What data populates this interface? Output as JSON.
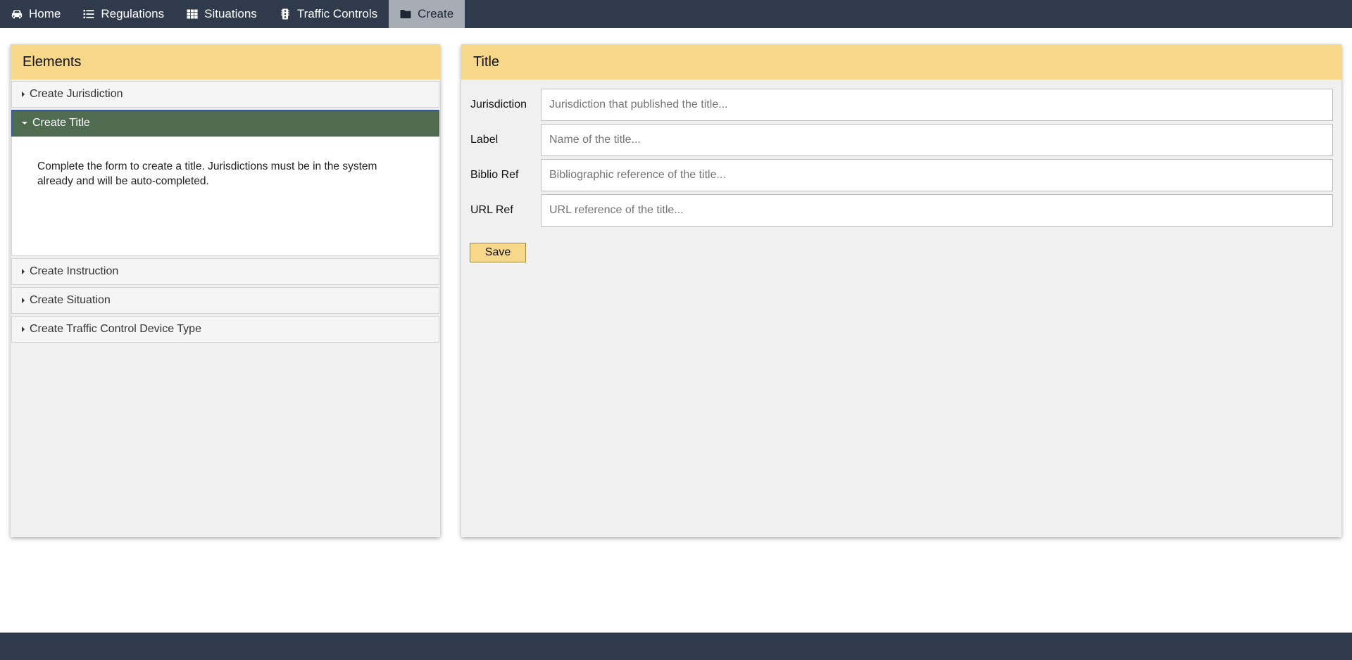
{
  "nav": {
    "items": [
      {
        "label": "Home",
        "icon": "car-icon"
      },
      {
        "label": "Regulations",
        "icon": "list-icon"
      },
      {
        "label": "Situations",
        "icon": "table-icon"
      },
      {
        "label": "Traffic Controls",
        "icon": "traffic-light-icon"
      },
      {
        "label": "Create",
        "icon": "folder-plus-icon",
        "active": true
      }
    ]
  },
  "elements_panel": {
    "title": "Elements",
    "items": [
      {
        "label": "Create Jurisdiction",
        "expanded": false
      },
      {
        "label": "Create Title",
        "expanded": true,
        "description": "Complete the form to create a title. Jurisdictions must be in the system already and will be auto-completed."
      },
      {
        "label": "Create Instruction",
        "expanded": false
      },
      {
        "label": "Create Situation",
        "expanded": false
      },
      {
        "label": "Create Traffic Control Device Type",
        "expanded": false
      }
    ]
  },
  "form_panel": {
    "title": "Title",
    "fields": [
      {
        "label": "Jurisdiction",
        "value": "",
        "placeholder": "Jurisdiction that published the title..."
      },
      {
        "label": "Label",
        "value": "",
        "placeholder": "Name of the title..."
      },
      {
        "label": "Biblio Ref",
        "value": "",
        "placeholder": "Bibliographic reference of the title..."
      },
      {
        "label": "URL Ref",
        "value": "",
        "placeholder": "URL reference of the title..."
      }
    ],
    "save_label": "Save"
  },
  "colors": {
    "nav_bg": "#2f3b4c",
    "nav_active_bg": "#a6adb5",
    "panel_header": "#f7d88b",
    "accordion_active": "#4f6b50",
    "panel_bg": "#f0f0f0"
  }
}
